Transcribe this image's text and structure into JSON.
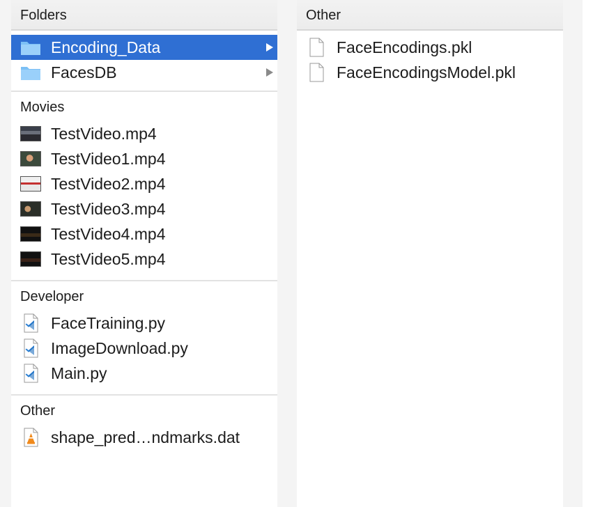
{
  "columns": {
    "left": {
      "header": "Folders",
      "folders": [
        {
          "label": "Encoding_Data",
          "selected": true,
          "icon": "folder-icon"
        },
        {
          "label": "FacesDB",
          "selected": false,
          "icon": "folder-icon"
        }
      ],
      "groups": {
        "movies": {
          "label": "Movies",
          "items": [
            {
              "label": "TestVideo.mp4",
              "icon": "video-thumbnail-icon"
            },
            {
              "label": "TestVideo1.mp4",
              "icon": "video-thumbnail-icon"
            },
            {
              "label": "TestVideo2.mp4",
              "icon": "video-thumbnail-icon"
            },
            {
              "label": "TestVideo3.mp4",
              "icon": "video-thumbnail-icon"
            },
            {
              "label": "TestVideo4.mp4",
              "icon": "video-thumbnail-icon"
            },
            {
              "label": "TestVideo5.mp4",
              "icon": "video-thumbnail-icon"
            }
          ]
        },
        "developer": {
          "label": "Developer",
          "items": [
            {
              "label": "FaceTraining.py",
              "icon": "vscode-file-icon"
            },
            {
              "label": "ImageDownload.py",
              "icon": "vscode-file-icon"
            },
            {
              "label": "Main.py",
              "icon": "vscode-file-icon"
            }
          ]
        },
        "other": {
          "label": "Other",
          "items": [
            {
              "label": "shape_pred…ndmarks.dat",
              "icon": "vlc-file-icon"
            }
          ]
        }
      }
    },
    "middle": {
      "header": "Other",
      "items": [
        {
          "label": "FaceEncodings.pkl",
          "icon": "blank-document-icon"
        },
        {
          "label": "FaceEncodingsModel.pkl",
          "icon": "blank-document-icon"
        }
      ]
    }
  },
  "colors": {
    "selection": "#2f6fd3",
    "folder": "#6cb4f0",
    "header_bg": "#ececec"
  }
}
